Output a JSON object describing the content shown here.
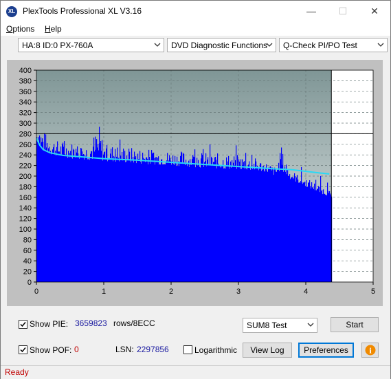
{
  "window": {
    "title": "PlexTools Professional XL V3.16",
    "app_icon_text": "XL",
    "minimize": "—",
    "maximize": "☐",
    "close": "✕"
  },
  "menu": {
    "items": [
      {
        "label": "Options",
        "underline": "O"
      },
      {
        "label": "Help",
        "underline": "H"
      }
    ]
  },
  "toolbar": {
    "drive": "HA:8 ID:0  PX-760A",
    "function": "DVD Diagnostic Functions",
    "test": "Q-Check PI/PO Test"
  },
  "chart_data": {
    "type": "area",
    "xlim": [
      0,
      5
    ],
    "ylim": [
      0,
      400
    ],
    "x_ticks": [
      "0",
      "1",
      "2",
      "3",
      "4",
      "5"
    ],
    "y_ticks": [
      "0",
      "20",
      "40",
      "60",
      "80",
      "100",
      "120",
      "140",
      "160",
      "180",
      "200",
      "220",
      "240",
      "260",
      "280",
      "300",
      "320",
      "340",
      "360",
      "380",
      "400"
    ],
    "grid": true,
    "end_x": 4.38,
    "threshold_y": 280,
    "colors": {
      "bars": "#0000ff",
      "average_line": "#29d9f5",
      "plot_bg_top": "#7f9696",
      "plot_bg_bottom": "#e8ecec",
      "outer_bg": "#c0c0c0"
    },
    "pie_peaks": [
      {
        "x": 0.0,
        "y": 280
      },
      {
        "x": 0.03,
        "y": 305
      },
      {
        "x": 0.06,
        "y": 290
      },
      {
        "x": 0.15,
        "y": 275
      },
      {
        "x": 0.3,
        "y": 265
      },
      {
        "x": 0.5,
        "y": 262
      },
      {
        "x": 0.75,
        "y": 258
      },
      {
        "x": 0.93,
        "y": 290
      },
      {
        "x": 1.0,
        "y": 258
      },
      {
        "x": 1.25,
        "y": 255
      },
      {
        "x": 1.5,
        "y": 250
      },
      {
        "x": 1.75,
        "y": 248
      },
      {
        "x": 2.0,
        "y": 245
      },
      {
        "x": 2.25,
        "y": 245
      },
      {
        "x": 2.5,
        "y": 242
      },
      {
        "x": 2.75,
        "y": 240
      },
      {
        "x": 3.0,
        "y": 238
      },
      {
        "x": 3.25,
        "y": 232
      },
      {
        "x": 3.45,
        "y": 222
      },
      {
        "x": 3.55,
        "y": 215
      },
      {
        "x": 3.62,
        "y": 245
      },
      {
        "x": 3.68,
        "y": 238
      },
      {
        "x": 3.75,
        "y": 212
      },
      {
        "x": 3.9,
        "y": 200
      },
      {
        "x": 4.05,
        "y": 192
      },
      {
        "x": 4.2,
        "y": 182
      },
      {
        "x": 4.3,
        "y": 175
      },
      {
        "x": 4.38,
        "y": 168
      }
    ],
    "pie_base": [
      {
        "x": 0.0,
        "y": 270
      },
      {
        "x": 0.05,
        "y": 250
      },
      {
        "x": 0.2,
        "y": 240
      },
      {
        "x": 0.5,
        "y": 233
      },
      {
        "x": 1.0,
        "y": 228
      },
      {
        "x": 1.5,
        "y": 223
      },
      {
        "x": 2.0,
        "y": 220
      },
      {
        "x": 2.5,
        "y": 215
      },
      {
        "x": 3.0,
        "y": 212
      },
      {
        "x": 3.4,
        "y": 208
      },
      {
        "x": 3.55,
        "y": 200
      },
      {
        "x": 3.62,
        "y": 212
      },
      {
        "x": 3.75,
        "y": 195
      },
      {
        "x": 4.0,
        "y": 180
      },
      {
        "x": 4.2,
        "y": 168
      },
      {
        "x": 4.38,
        "y": 160
      }
    ],
    "average": [
      {
        "x": 0.0,
        "y": 272
      },
      {
        "x": 0.05,
        "y": 258
      },
      {
        "x": 0.1,
        "y": 250
      },
      {
        "x": 0.2,
        "y": 244
      },
      {
        "x": 0.4,
        "y": 239
      },
      {
        "x": 0.7,
        "y": 236
      },
      {
        "x": 1.0,
        "y": 233
      },
      {
        "x": 1.5,
        "y": 230
      },
      {
        "x": 2.0,
        "y": 226
      },
      {
        "x": 2.5,
        "y": 222
      },
      {
        "x": 3.0,
        "y": 218
      },
      {
        "x": 3.5,
        "y": 214
      },
      {
        "x": 3.8,
        "y": 212
      },
      {
        "x": 4.0,
        "y": 209
      },
      {
        "x": 4.2,
        "y": 206
      },
      {
        "x": 4.35,
        "y": 204
      }
    ]
  },
  "bottom": {
    "show_pie_label": "Show PIE:",
    "show_pie_checked": true,
    "pie_value": "3659823",
    "rows_label": "rows/8ECC",
    "show_pof_label": "Show POF:",
    "show_pof_checked": true,
    "pof_value": "0",
    "lsn_label": "LSN:",
    "lsn_value": "2297856",
    "logarithmic_label": "Logarithmic",
    "logarithmic_checked": false,
    "sum_select": "SUM8 Test",
    "start_button": "Start",
    "view_log_button": "View Log",
    "preferences_button": "Preferences",
    "info_icon": "i"
  },
  "status": {
    "text": "Ready"
  }
}
